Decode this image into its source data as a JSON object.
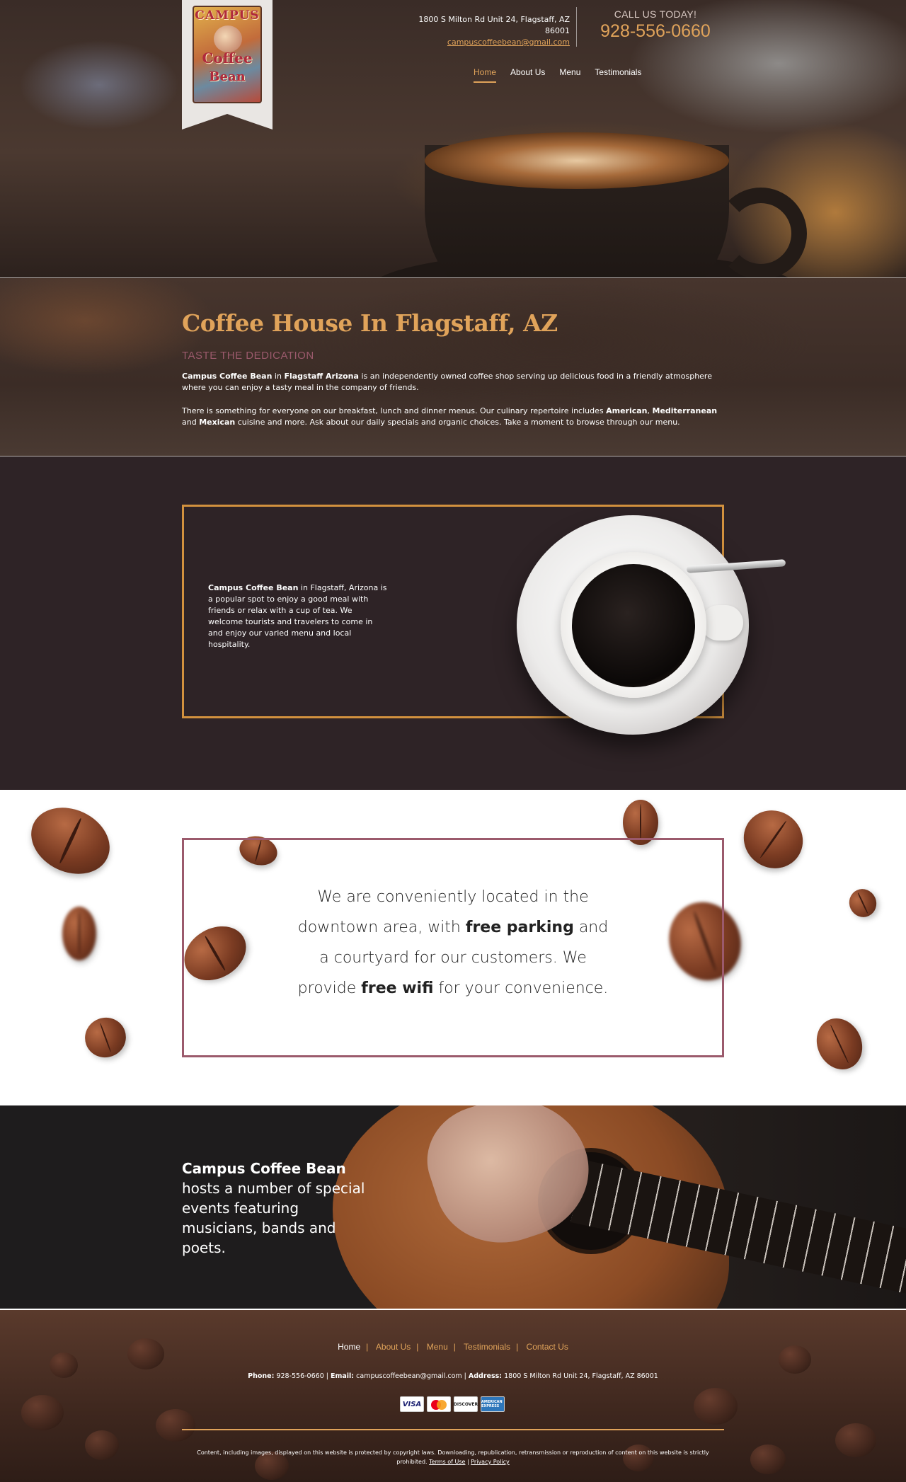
{
  "header": {
    "logo": {
      "line1": "CAMPUS",
      "line2": "Coffee",
      "line3": "Bean"
    },
    "address": "1800 S Milton Rd Unit 24, Flagstaff, AZ 86001",
    "email": "campuscoffeebean@gmail.com",
    "call_label": "CALL US TODAY!",
    "phone": "928-556-0660",
    "nav": [
      "Home",
      "About Us",
      "Menu",
      "Testimonials"
    ]
  },
  "intro": {
    "title": "Coffee House In Flagstaff, AZ",
    "tagline": "TASTE THE DEDICATION",
    "p1_bold1": "Campus Coffee Bean",
    "p1_mid": " in ",
    "p1_bold2": "Flagstaff Arizona",
    "p1_rest": " is an independently owned coffee shop serving up delicious food in a friendly atmosphere where you can enjoy a tasty meal in the company of friends.",
    "p2_start": "There is something for everyone on our breakfast, lunch and dinner menus. Our culinary repertoire includes ",
    "p2_b1": "American",
    "p2_c1": ", ",
    "p2_b2": "Mediterranean",
    "p2_c2": " and ",
    "p2_b3": "Mexican",
    "p2_end": " cuisine and more. Ask about our daily specials and organic choices. Take a moment to browse through our menu."
  },
  "about": {
    "bold": "Campus Coffee Bean",
    "text": " in Flagstaff, Arizona is a popular spot to enjoy a good meal with friends or relax with a cup of tea. We welcome tourists and travelers to come in and enjoy our varied menu and local hospitality."
  },
  "location": {
    "t1": "We are conveniently located in the downtown area, with ",
    "b1": "free parking",
    "t2": " and a courtyard for our customers. We provide ",
    "b2": "free wifi",
    "t3": " for your convenience."
  },
  "events": {
    "bold": "Campus Coffee Bean",
    "text": " hosts a number of special events featuring musicians, bands and poets."
  },
  "footer": {
    "nav": [
      "Home",
      "About Us",
      "Menu",
      "Testimonials",
      "Contact Us"
    ],
    "phone_label": "Phone:",
    "phone": "928-556-0660",
    "email_label": "Email:",
    "email": "campuscoffeebean@gmail.com",
    "address_label": "Address:",
    "address": "1800 S Milton Rd Unit 24, Flagstaff, AZ 86001",
    "cards": [
      "VISA",
      "MasterCard",
      "DISCOVER",
      "AMERICAN EXPRESS"
    ],
    "copyright": "Content, including images, displayed on this website is protected by copyright laws. Downloading, republication, retransmission or reproduction of content on this website is strictly prohibited.",
    "terms": "Terms of Use",
    "privacy": "Privacy Policy"
  },
  "colors": {
    "accent": "#e0a35a",
    "mauve": "#9b5a6c",
    "dark": "#2e2326"
  }
}
